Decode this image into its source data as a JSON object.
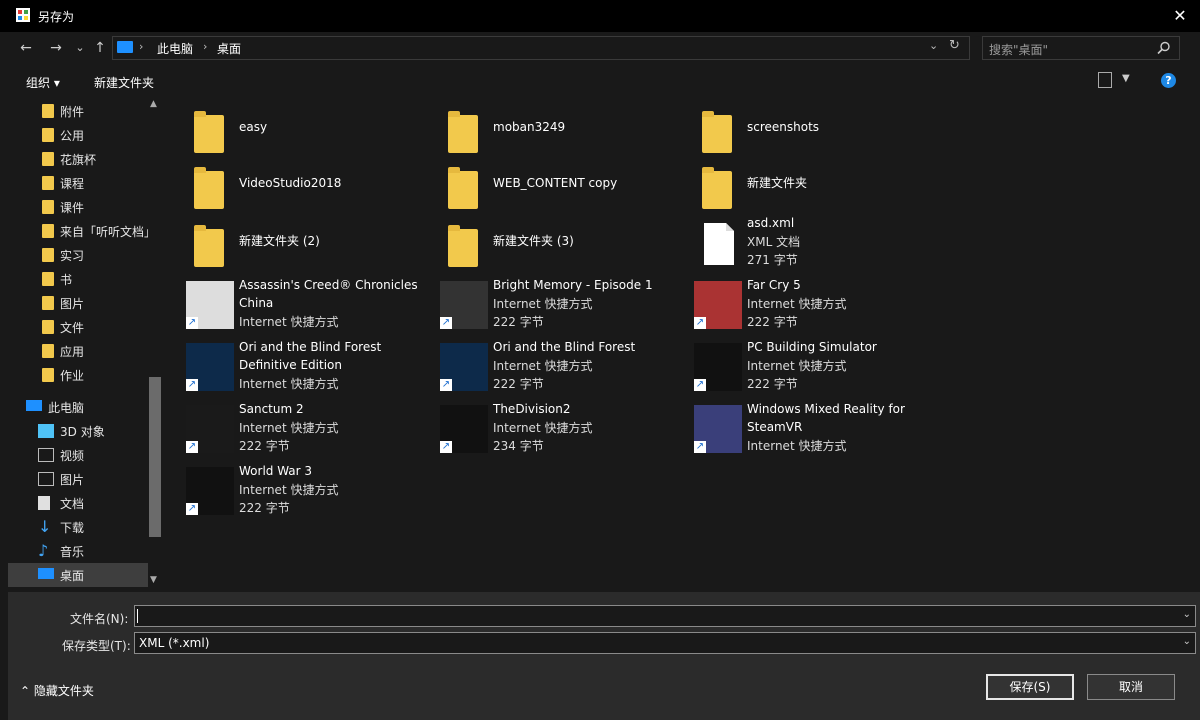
{
  "window": {
    "title": "另存为",
    "close_glyph": "✕"
  },
  "nav": {
    "back": "←",
    "forward": "→",
    "recent": "⌄",
    "up": "↑",
    "breadcrumb": [
      "此电脑",
      "桌面"
    ],
    "sep": "›",
    "dropdown": "⌄",
    "refresh": "↻"
  },
  "search": {
    "placeholder": "搜索\"桌面\""
  },
  "toolbar": {
    "organize": "组织 ▾",
    "new_folder": "新建文件夹"
  },
  "sidebar": {
    "items": [
      {
        "label": "附件",
        "icon": "folder-icon"
      },
      {
        "label": "公用",
        "icon": "folder-icon"
      },
      {
        "label": "花旗杯",
        "icon": "folder-icon"
      },
      {
        "label": "课程",
        "icon": "folder-icon"
      },
      {
        "label": "课件",
        "icon": "folder-icon"
      },
      {
        "label": "来自「听听文档」",
        "icon": "folder-icon"
      },
      {
        "label": "实习",
        "icon": "folder-icon"
      },
      {
        "label": "书",
        "icon": "folder-icon"
      },
      {
        "label": "图片",
        "icon": "folder-icon"
      },
      {
        "label": "文件",
        "icon": "folder-icon"
      },
      {
        "label": "应用",
        "icon": "folder-icon"
      },
      {
        "label": "作业",
        "icon": "folder-icon"
      },
      {
        "label": "此电脑",
        "icon": "pc-icon"
      },
      {
        "label": "3D 对象",
        "icon": "cube-icon"
      },
      {
        "label": "视频",
        "icon": "video-icon"
      },
      {
        "label": "图片",
        "icon": "picture-icon"
      },
      {
        "label": "文档",
        "icon": "document-icon"
      },
      {
        "label": "下载",
        "icon": "download-icon"
      },
      {
        "label": "音乐",
        "icon": "music-icon"
      },
      {
        "label": "桌面",
        "icon": "desktop-icon"
      }
    ]
  },
  "files": [
    {
      "name": "easy",
      "lines": [],
      "kind": "folder"
    },
    {
      "name": "moban3249",
      "lines": [],
      "kind": "folder"
    },
    {
      "name": "screenshots",
      "lines": [],
      "kind": "folder"
    },
    {
      "name": "VideoStudio2018",
      "lines": [],
      "kind": "folder"
    },
    {
      "name": "WEB_CONTENT copy",
      "lines": [],
      "kind": "folder"
    },
    {
      "name": "新建文件夹",
      "lines": [],
      "kind": "folder"
    },
    {
      "name": "新建文件夹 (2)",
      "lines": [],
      "kind": "folder"
    },
    {
      "name": "新建文件夹 (3)",
      "lines": [],
      "kind": "folder"
    },
    {
      "name": "asd.xml",
      "lines": [
        "XML 文档",
        "271 字节"
      ],
      "kind": "xml"
    },
    {
      "name": "Assassin's Creed® Chronicles",
      "name2": "China",
      "lines": [
        "Internet 快捷方式"
      ],
      "kind": "game",
      "color": "#ddd"
    },
    {
      "name": "Bright Memory - Episode 1",
      "lines": [
        "Internet 快捷方式",
        "222 字节"
      ],
      "kind": "game",
      "color": "#333"
    },
    {
      "name": "Far Cry 5",
      "lines": [
        "Internet 快捷方式",
        "222 字节"
      ],
      "kind": "game",
      "color": "#a33"
    },
    {
      "name": "Ori and the Blind Forest",
      "name2": "Definitive Edition",
      "lines": [
        "Internet 快捷方式"
      ],
      "kind": "game",
      "color": "#0d2a4a"
    },
    {
      "name": "Ori and the Blind Forest",
      "lines": [
        "Internet 快捷方式",
        "222 字节"
      ],
      "kind": "game",
      "color": "#0d2a4a"
    },
    {
      "name": "PC Building Simulator",
      "lines": [
        "Internet 快捷方式",
        "222 字节"
      ],
      "kind": "game",
      "color": "#111"
    },
    {
      "name": "Sanctum 2",
      "lines": [
        "Internet 快捷方式",
        "222 字节"
      ],
      "kind": "game",
      "color": "#1a1a1a"
    },
    {
      "name": "TheDivision2",
      "lines": [
        "Internet 快捷方式",
        "234 字节"
      ],
      "kind": "game",
      "color": "#111"
    },
    {
      "name": "Windows Mixed Reality for",
      "name2": "SteamVR",
      "lines": [
        "Internet 快捷方式"
      ],
      "kind": "game",
      "color": "#3a3f7a"
    },
    {
      "name": "World War 3",
      "lines": [
        "Internet 快捷方式",
        "222 字节"
      ],
      "kind": "game",
      "color": "#111"
    }
  ],
  "form": {
    "filename_label": "文件名(N):",
    "filename_value": "",
    "type_label": "保存类型(T):",
    "type_value": "XML (*.xml)",
    "dd": "⌄"
  },
  "footer": {
    "hide_folders": "⌃ 隐藏文件夹",
    "save": "保存(S)",
    "cancel": "取消"
  }
}
